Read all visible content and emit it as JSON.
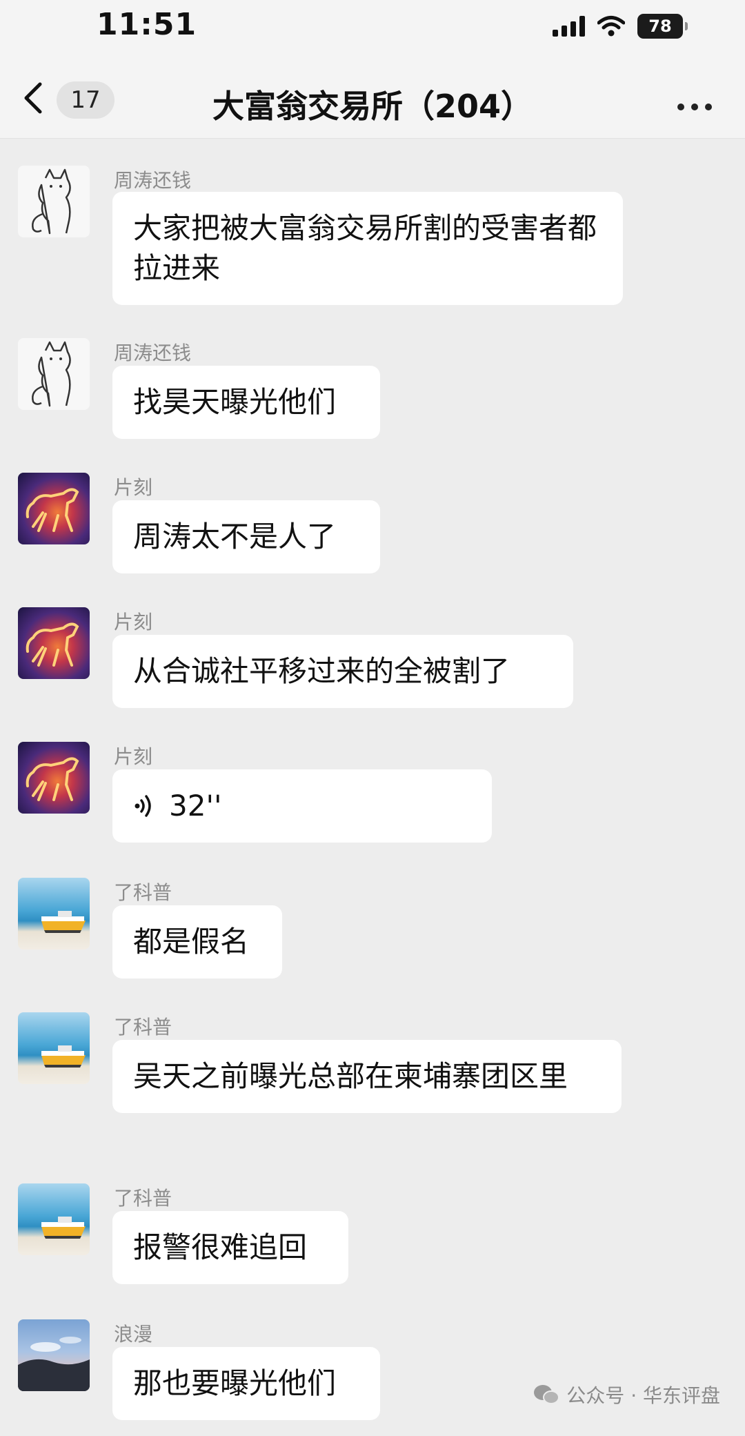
{
  "status_bar": {
    "time": "11:51",
    "battery": "78"
  },
  "nav": {
    "unread_count": "17",
    "title": "大富翁交易所（204）"
  },
  "messages": [
    {
      "sender": "周涛还钱",
      "avatar": "cat-sketch",
      "text": "大家把被大富翁交易所割的受害者都拉进来"
    },
    {
      "sender": "周涛还钱",
      "avatar": "cat-sketch",
      "text": "找昊天曝光他们"
    },
    {
      "sender": "片刻",
      "avatar": "fire-horse",
      "text": "周涛太不是人了"
    },
    {
      "sender": "片刻",
      "avatar": "fire-horse",
      "text": "从合诚社平移过来的全被割了"
    },
    {
      "sender": "片刻",
      "avatar": "fire-horse",
      "text": "32''"
    },
    {
      "sender": "了科普",
      "avatar": "boat-on-beach",
      "text": "都是假名"
    },
    {
      "sender": "了科普",
      "avatar": "boat-on-beach",
      "text": "吴天之前曝光总部在柬埔寨团区里"
    },
    {
      "sender": "了科普",
      "avatar": "boat-on-beach",
      "text": "报警很难追回"
    },
    {
      "sender": "浪漫",
      "avatar": "sky-landscape",
      "text": "那也要曝光他们"
    }
  ],
  "watermark": "公众号 · 华东评盘",
  "colors": {
    "background": "#ededed",
    "bubble": "#ffffff",
    "sender_name": "#8c8c8c"
  }
}
